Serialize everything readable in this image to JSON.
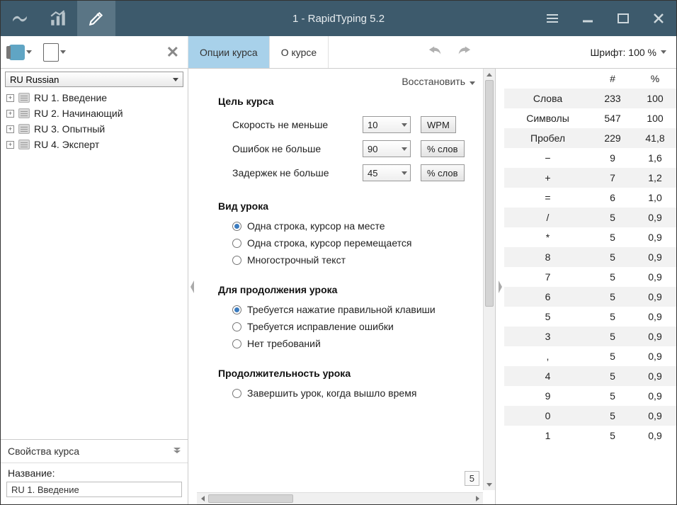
{
  "title": "1 - RapidTyping 5.2",
  "tabs": {
    "options": "Опции курса",
    "about": "О курсе"
  },
  "font_zoom": "Шрифт: 100 %",
  "sidebar": {
    "lang": "RU Russian",
    "items": [
      {
        "label": "RU 1. Введение"
      },
      {
        "label": "RU 2. Начинающий"
      },
      {
        "label": "RU 3. Опытный"
      },
      {
        "label": "RU 4. Эксперт"
      }
    ],
    "props_header": "Свойства курса",
    "name_label": "Название:",
    "name_value": "RU 1. Введение"
  },
  "main": {
    "restore": "Восстановить",
    "goal_title": "Цель курса",
    "goal_rows": [
      {
        "label": "Скорость не меньше",
        "value": "10",
        "unit": "WPM"
      },
      {
        "label": "Ошибок не больше",
        "value": "90",
        "unit": "% слов"
      },
      {
        "label": "Задержек не больше",
        "value": "45",
        "unit": "% слов"
      }
    ],
    "view_title": "Вид урока",
    "view_options": [
      "Одна строка, курсор на месте",
      "Одна строка, курсор перемещается",
      "Многострочный текст"
    ],
    "view_selected": 0,
    "continue_title": "Для продолжения урока",
    "continue_options": [
      "Требуется нажатие правильной клавиши",
      "Требуется исправление ошибки",
      "Нет требований"
    ],
    "continue_selected": 0,
    "duration_title": "Продолжительность урока",
    "duration_option": "Завершить урок, когда вышло время",
    "time_badge": "5"
  },
  "stats": {
    "head": {
      "hash": "#",
      "pct": "%"
    },
    "rows": [
      {
        "label": "Слова",
        "n": "233",
        "p": "100"
      },
      {
        "label": "Символы",
        "n": "547",
        "p": "100"
      },
      {
        "label": "Пробел",
        "n": "229",
        "p": "41,8"
      },
      {
        "label": "−",
        "n": "9",
        "p": "1,6"
      },
      {
        "label": "+",
        "n": "7",
        "p": "1,2"
      },
      {
        "label": "=",
        "n": "6",
        "p": "1,0"
      },
      {
        "label": "/",
        "n": "5",
        "p": "0,9"
      },
      {
        "label": "*",
        "n": "5",
        "p": "0,9"
      },
      {
        "label": "8",
        "n": "5",
        "p": "0,9"
      },
      {
        "label": "7",
        "n": "5",
        "p": "0,9"
      },
      {
        "label": "6",
        "n": "5",
        "p": "0,9"
      },
      {
        "label": "5",
        "n": "5",
        "p": "0,9"
      },
      {
        "label": "3",
        "n": "5",
        "p": "0,9"
      },
      {
        "label": ",",
        "n": "5",
        "p": "0,9"
      },
      {
        "label": "4",
        "n": "5",
        "p": "0,9"
      },
      {
        "label": "9",
        "n": "5",
        "p": "0,9"
      },
      {
        "label": "0",
        "n": "5",
        "p": "0,9"
      },
      {
        "label": "1",
        "n": "5",
        "p": "0,9"
      }
    ]
  }
}
